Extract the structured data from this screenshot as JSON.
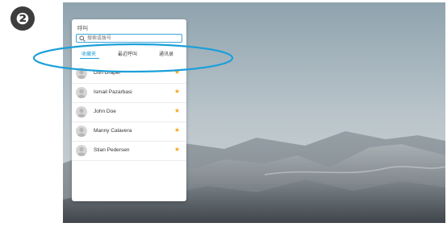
{
  "step_number": "❷",
  "panel": {
    "title": "呼叫",
    "search_placeholder": "搜索或拨号",
    "tabs": [
      {
        "label": "收藏夹",
        "active": true
      },
      {
        "label": "最近呼叫",
        "active": false
      },
      {
        "label": "通讯录",
        "active": false
      }
    ],
    "contacts": [
      {
        "name": "Don Draper",
        "favorite": "★"
      },
      {
        "name": "Ismail Pazarbasi",
        "favorite": "★"
      },
      {
        "name": "John Doe",
        "favorite": "★"
      },
      {
        "name": "Manny Calavera",
        "favorite": "★"
      },
      {
        "name": "Stian Pedersen",
        "favorite": "★"
      }
    ]
  },
  "colors": {
    "accent": "#1ca0d8",
    "highlight": "#1ca0d8",
    "star": "#f5a623"
  }
}
